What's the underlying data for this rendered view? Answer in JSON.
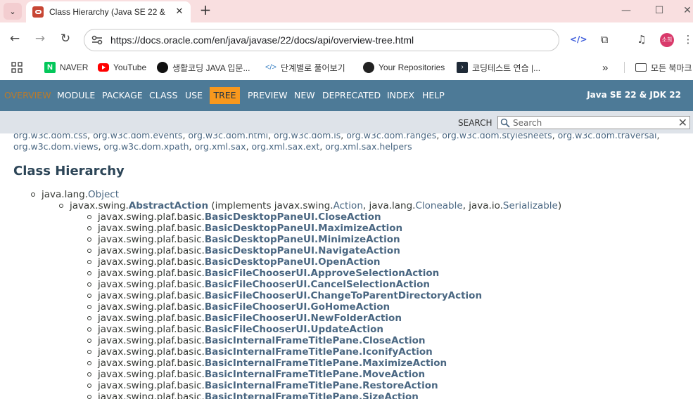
{
  "browser": {
    "tab_title": "Class Hierarchy (Java SE 22 &",
    "url": "https://docs.oracle.com/en/java/javase/22/docs/api/overview-tree.html",
    "profile_label": "소희",
    "bookmarks": [
      "NAVER",
      "YouTube",
      "생활코딩 JAVA 입문...",
      "단계별로 풀어보기",
      "Your Repositories",
      "코딩테스트 연습 |...",
      "모든 북마크"
    ]
  },
  "javadoc_nav": {
    "items": [
      "OVERVIEW",
      "MODULE",
      "PACKAGE",
      "CLASS",
      "USE",
      "TREE",
      "PREVIEW",
      "NEW",
      "DEPRECATED",
      "INDEX",
      "HELP"
    ],
    "brand": "Java SE 22 & JDK 22",
    "search_label": "SEARCH",
    "search_placeholder": "Search"
  },
  "packages_line1": [
    "org.w3c.dom.css",
    "org.w3c.dom.events",
    "org.w3c.dom.html",
    "org.w3c.dom.ls",
    "org.w3c.dom.ranges",
    "org.w3c.dom.stylesheets",
    "org.w3c.dom.traversal"
  ],
  "packages_line2": [
    "org.w3c.dom.views",
    "org.w3c.dom.xpath",
    "org.xml.sax",
    "org.xml.sax.ext",
    "org.xml.sax.helpers"
  ],
  "heading": "Class Hierarchy",
  "root": {
    "pkg": "java.lang.",
    "cls": "Object"
  },
  "abstract_action": {
    "pkg": "javax.swing.",
    "cls": "AbstractAction",
    "implements_prefix": "(implements javax.swing.",
    "iface1": "Action",
    "mid1": ", java.lang.",
    "iface2": "Cloneable",
    "mid2": ", java.io.",
    "iface3": "Serializable",
    "suffix": ")"
  },
  "subclasses_pkg": "javax.swing.plaf.basic.",
  "subclasses": [
    "BasicDesktopPaneUI.CloseAction",
    "BasicDesktopPaneUI.MaximizeAction",
    "BasicDesktopPaneUI.MinimizeAction",
    "BasicDesktopPaneUI.NavigateAction",
    "BasicDesktopPaneUI.OpenAction",
    "BasicFileChooserUI.ApproveSelectionAction",
    "BasicFileChooserUI.CancelSelectionAction",
    "BasicFileChooserUI.ChangeToParentDirectoryAction",
    "BasicFileChooserUI.GoHomeAction",
    "BasicFileChooserUI.NewFolderAction",
    "BasicFileChooserUI.UpdateAction",
    "BasicInternalFrameTitlePane.CloseAction",
    "BasicInternalFrameTitlePane.IconifyAction",
    "BasicInternalFrameTitlePane.MaximizeAction",
    "BasicInternalFrameTitlePane.MoveAction",
    "BasicInternalFrameTitlePane.RestoreAction",
    "BasicInternalFrameTitlePane.SizeAction"
  ]
}
